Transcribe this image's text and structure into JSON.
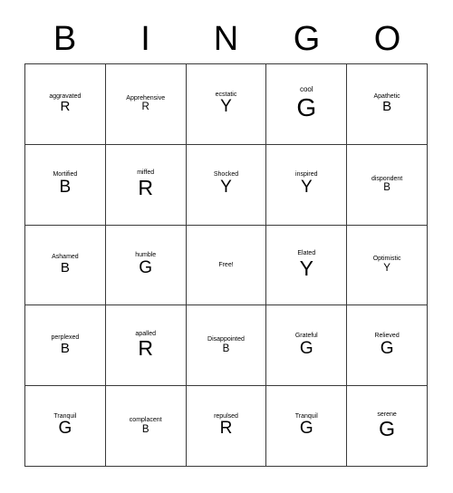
{
  "card": {
    "header_letters": [
      "B",
      "I",
      "N",
      "G",
      "O"
    ],
    "grid": {
      "rows": 5,
      "columns": 5,
      "cells": [
        {
          "word": "aggravated",
          "letter": "R",
          "size": "sm"
        },
        {
          "word": "Apprehensive",
          "letter": "R",
          "size": "xs"
        },
        {
          "word": "ecstatic",
          "letter": "Y",
          "size": "md"
        },
        {
          "word": "cool",
          "letter": "G",
          "size": "xl"
        },
        {
          "word": "Apathetic",
          "letter": "B",
          "size": "sm"
        },
        {
          "word": "Mortified",
          "letter": "B",
          "size": "md"
        },
        {
          "word": "miffed",
          "letter": "R",
          "size": "lg"
        },
        {
          "word": "Shocked",
          "letter": "Y",
          "size": "md"
        },
        {
          "word": "inspired",
          "letter": "Y",
          "size": "md"
        },
        {
          "word": "dispondent",
          "letter": "B",
          "size": "xs"
        },
        {
          "word": "Ashamed",
          "letter": "B",
          "size": "sm"
        },
        {
          "word": "humble",
          "letter": "G",
          "size": "md"
        },
        {
          "word": "Free!",
          "letter": "",
          "size": "free"
        },
        {
          "word": "Elated",
          "letter": "Y",
          "size": "lg"
        },
        {
          "word": "Optimistic",
          "letter": "Y",
          "size": "xs"
        },
        {
          "word": "perplexed",
          "letter": "B",
          "size": "sm"
        },
        {
          "word": "apalled",
          "letter": "R",
          "size": "lg"
        },
        {
          "word": "Disappointed",
          "letter": "B",
          "size": "xs"
        },
        {
          "word": "Grateful",
          "letter": "G",
          "size": "md"
        },
        {
          "word": "Relieved",
          "letter": "G",
          "size": "md"
        },
        {
          "word": "Tranquil",
          "letter": "G",
          "size": "md"
        },
        {
          "word": "complacent",
          "letter": "B",
          "size": "xs"
        },
        {
          "word": "repulsed",
          "letter": "R",
          "size": "md"
        },
        {
          "word": "Tranquil",
          "letter": "G",
          "size": "md"
        },
        {
          "word": "serene",
          "letter": "G",
          "size": "lg"
        }
      ]
    },
    "colors": {
      "border": "#3a3a3a",
      "text": "#000000",
      "background": "#ffffff"
    }
  }
}
